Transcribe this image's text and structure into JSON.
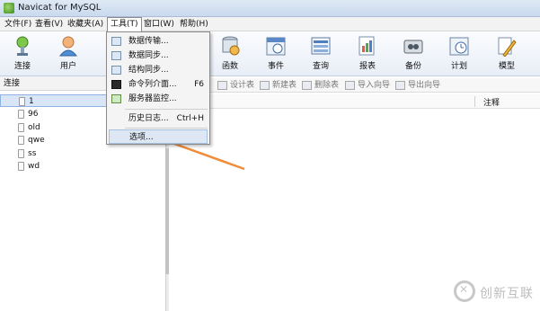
{
  "window": {
    "title": "Navicat for MySQL"
  },
  "menubar": {
    "items": [
      "文件(F)",
      "查看(V)",
      "收藏夹(A)",
      "工具(T)",
      "窗口(W)",
      "帮助(H)"
    ]
  },
  "toolbar": {
    "buttons": [
      {
        "label": "连接",
        "icon": "connect-icon"
      },
      {
        "label": "用户",
        "icon": "user-icon"
      },
      {
        "label": "函数",
        "icon": "function-icon"
      },
      {
        "label": "事件",
        "icon": "event-icon"
      },
      {
        "label": "查询",
        "icon": "query-icon"
      },
      {
        "label": "报表",
        "icon": "report-icon"
      },
      {
        "label": "备份",
        "icon": "backup-icon"
      },
      {
        "label": "计划",
        "icon": "schedule-icon"
      },
      {
        "label": "模型",
        "icon": "model-icon"
      }
    ]
  },
  "left_panel": {
    "header": "连接",
    "items": [
      "1",
      "96",
      "old",
      "qwe",
      "ss",
      "wd"
    ],
    "selected_index": 0
  },
  "object_toolbar": {
    "buttons": [
      "设计表",
      "新建表",
      "删除表",
      "导入向导",
      "导出向导"
    ]
  },
  "content": {
    "column_header": "注释"
  },
  "tools_menu": {
    "items": [
      {
        "label": "数据传输...",
        "shortcut": "",
        "icon": "data-transfer-icon"
      },
      {
        "label": "数据同步...",
        "shortcut": "",
        "icon": "data-sync-icon"
      },
      {
        "label": "结构同步...",
        "shortcut": "",
        "icon": "structure-sync-icon"
      },
      {
        "label": "命令列介面...",
        "shortcut": "F6",
        "icon": "command-line-icon"
      },
      {
        "label": "服务器监控...",
        "shortcut": "",
        "icon": "server-monitor-icon"
      },
      {
        "label": "历史日志...",
        "shortcut": "Ctrl+H",
        "icon": ""
      },
      {
        "label": "选项...",
        "shortcut": "",
        "icon": ""
      }
    ]
  },
  "watermark": {
    "text": "创新互联"
  },
  "colors": {
    "arrow": "#f08c3a",
    "selection": "#d8e6f7"
  }
}
